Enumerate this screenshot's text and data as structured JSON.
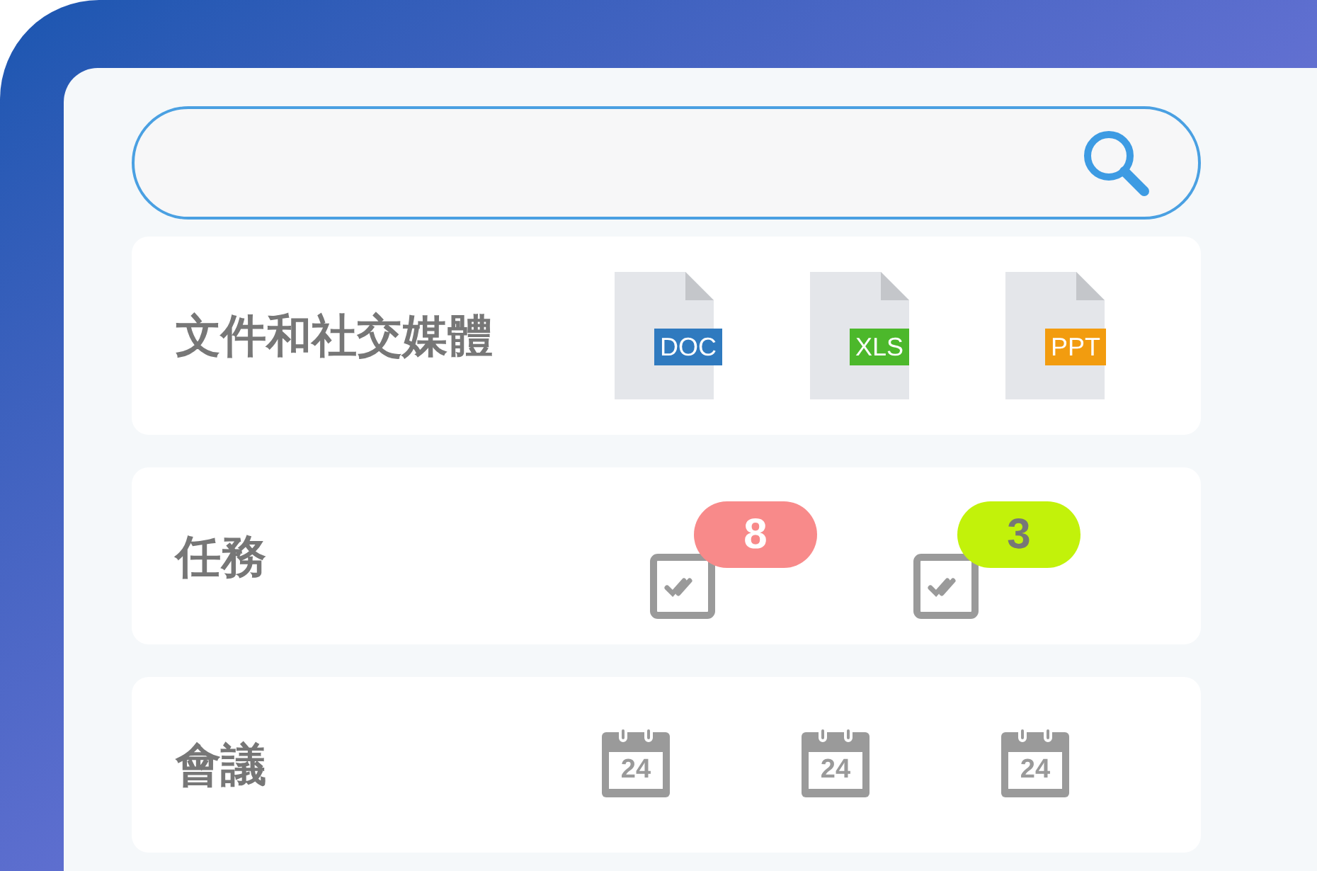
{
  "sections": [
    {
      "kind": "files",
      "title": "文件和社交媒體",
      "files": [
        {
          "label": "DOC",
          "color": "#2f7abf"
        },
        {
          "label": "XLS",
          "color": "#4cb82b"
        },
        {
          "label": "PPT",
          "color": "#f29c0f"
        }
      ]
    },
    {
      "kind": "tasks",
      "title": "任務",
      "tasks": [
        {
          "count": "8",
          "color": "#f88a8a"
        },
        {
          "count": "3",
          "color": "#c2f20a"
        }
      ]
    },
    {
      "kind": "meetings",
      "title": "會議",
      "meetings": [
        {
          "day": "24"
        },
        {
          "day": "24"
        },
        {
          "day": "24"
        }
      ]
    }
  ]
}
